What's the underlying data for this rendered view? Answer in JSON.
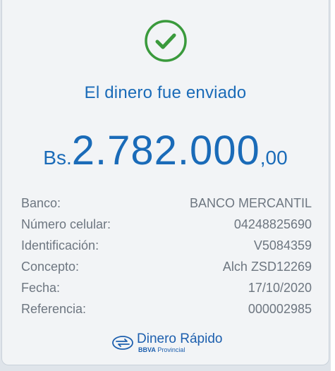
{
  "confirmation": {
    "title": "El dinero fue enviado",
    "amount": {
      "currency": "Bs.",
      "main": "2.782.000",
      "cents": ",00"
    }
  },
  "details": [
    {
      "label": "Banco:",
      "value": "BANCO MERCANTIL"
    },
    {
      "label": "Número celular:",
      "value": "04248825690"
    },
    {
      "label": "Identificación:",
      "value": "V5084359"
    },
    {
      "label": "Concepto:",
      "value": "Alch ZSD12269"
    },
    {
      "label": "Fecha:",
      "value": "17/10/2020"
    },
    {
      "label": "Referencia:",
      "value": "000002985"
    }
  ],
  "brand": {
    "name": "Dinero Rápido",
    "sub_bold": "BBVA",
    "sub_rest": " Provincial"
  },
  "colors": {
    "accent_blue": "#1a6bb8",
    "success_green": "#3a9a3c",
    "text_gray": "#6d7680"
  },
  "icons": {
    "status": "check-circle-icon",
    "brand": "transfer-arrows-icon"
  }
}
